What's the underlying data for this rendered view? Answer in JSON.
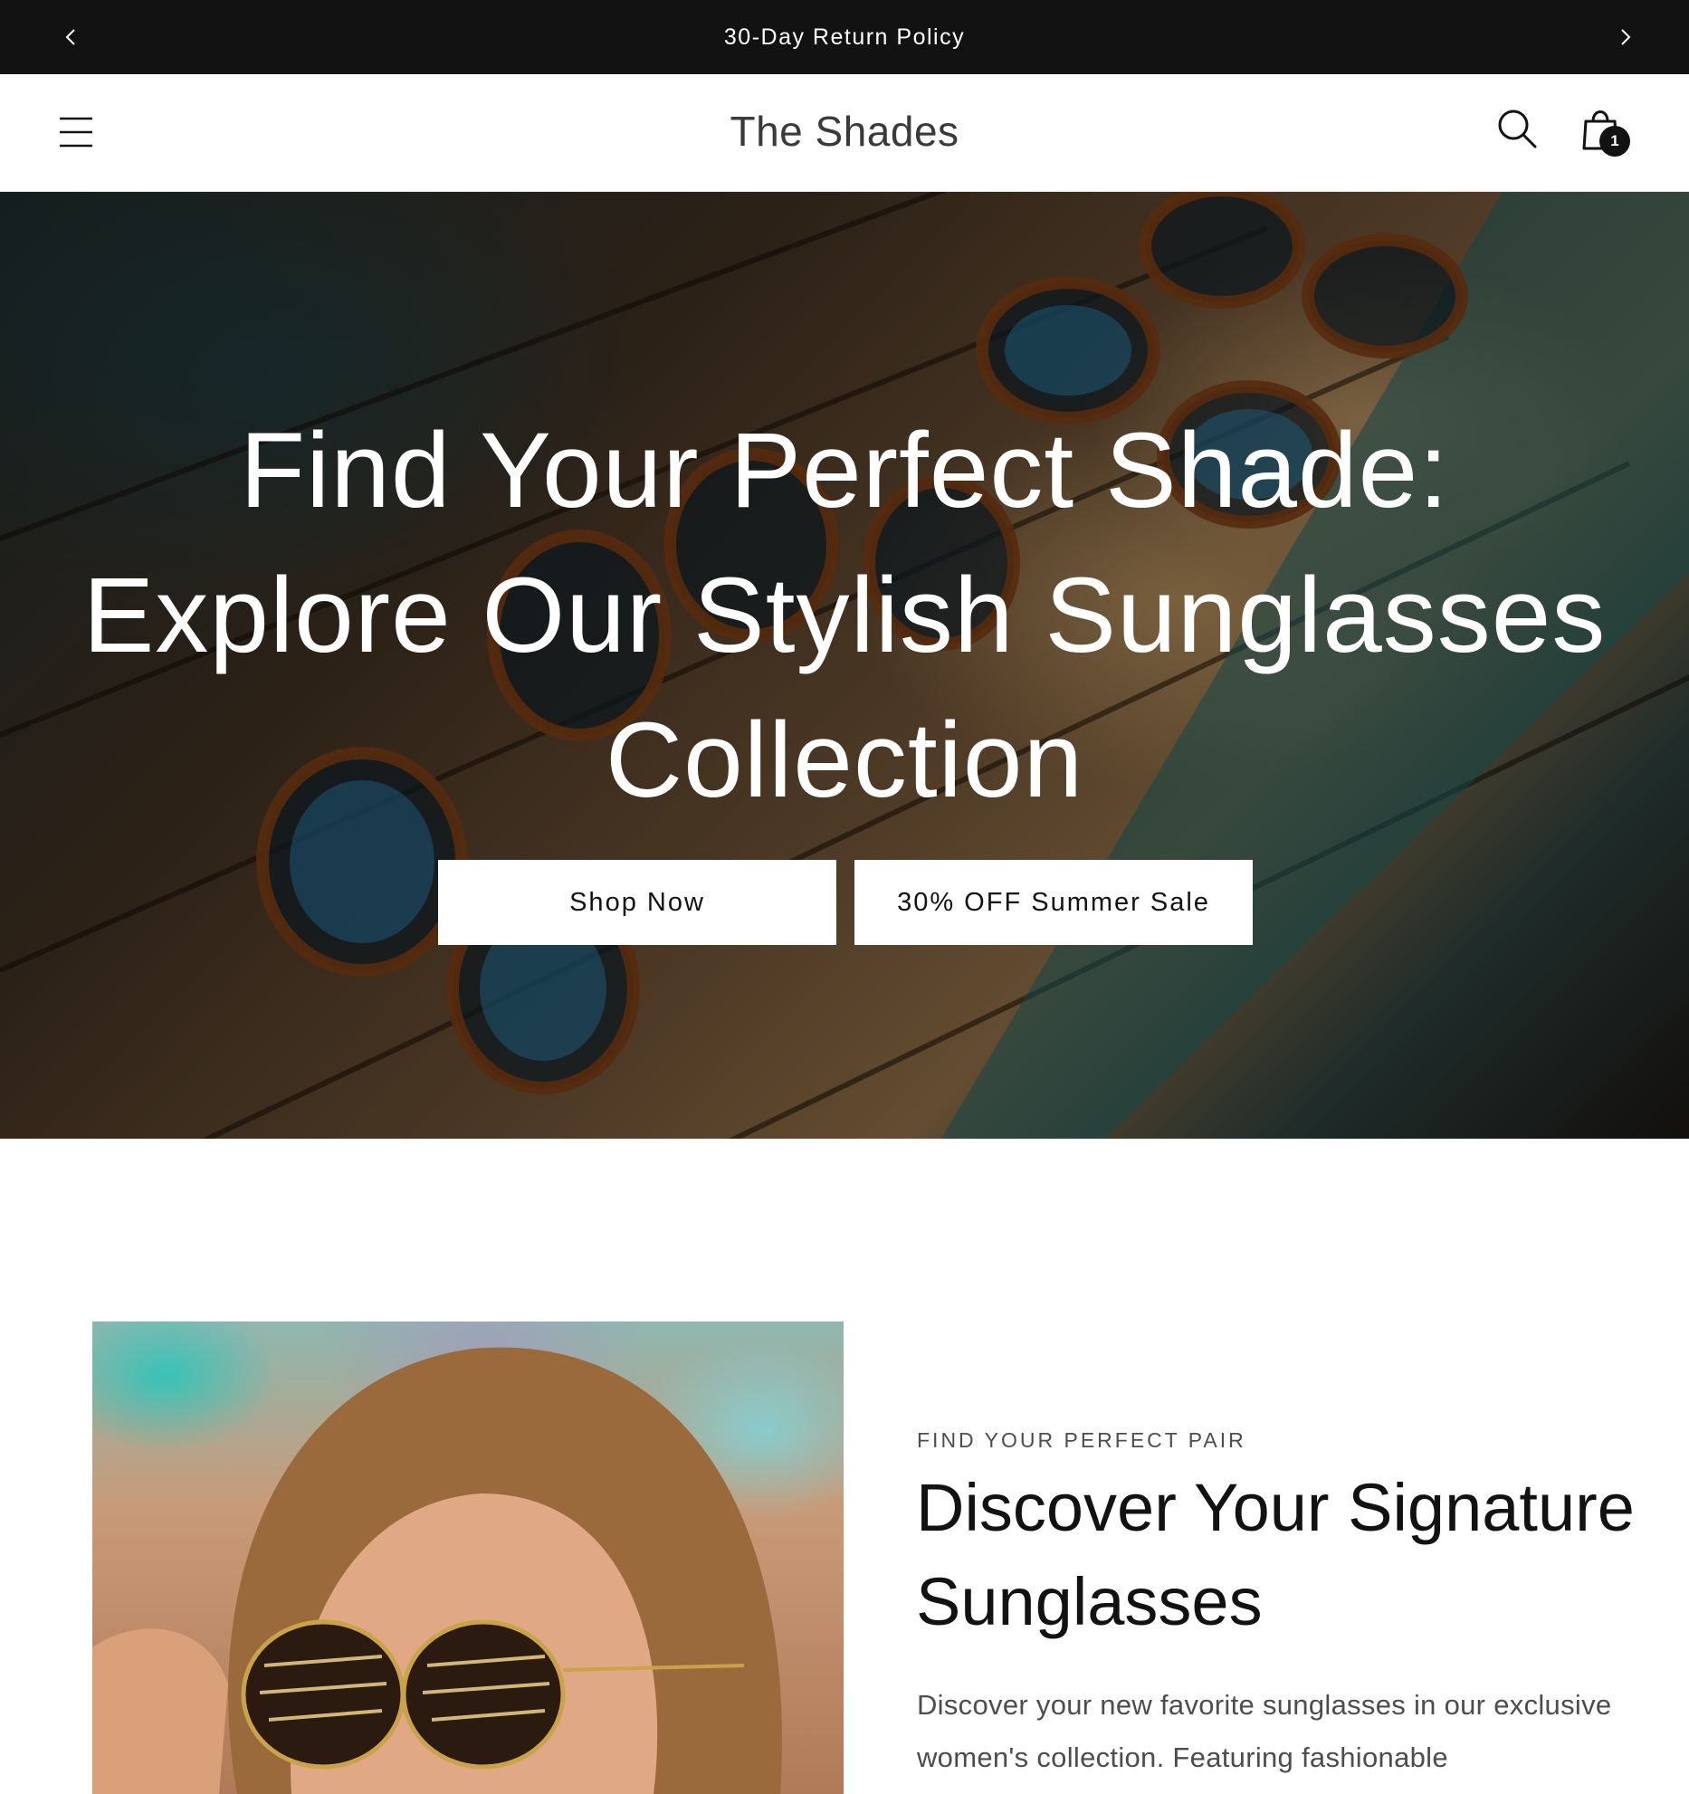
{
  "announcement": {
    "text": "30-Day Return Policy",
    "prev_icon": "chevron-left-icon",
    "next_icon": "chevron-right-icon"
  },
  "header": {
    "logo": "The Shades",
    "menu_icon": "hamburger-menu-icon",
    "search_icon": "search-icon",
    "cart_icon": "shopping-bag-icon",
    "cart_count": "1"
  },
  "hero": {
    "title": "Find Your Perfect Shade: Explore Our Stylish Sunglasses Collection",
    "buttons": {
      "primary_label": "Shop Now",
      "secondary_label": "30% OFF Summer Sale"
    }
  },
  "feature": {
    "eyebrow": "FIND YOUR PERFECT PAIR",
    "heading": "Discover Your Signature Sunglasses",
    "body": "Discover your new favorite sunglasses in our exclusive women's collection. Featuring fashionable"
  },
  "colors": {
    "announcement_bg": "#121212",
    "text_primary": "#121212",
    "text_secondary": "#4d4d4d",
    "button_bg": "#ffffff"
  }
}
